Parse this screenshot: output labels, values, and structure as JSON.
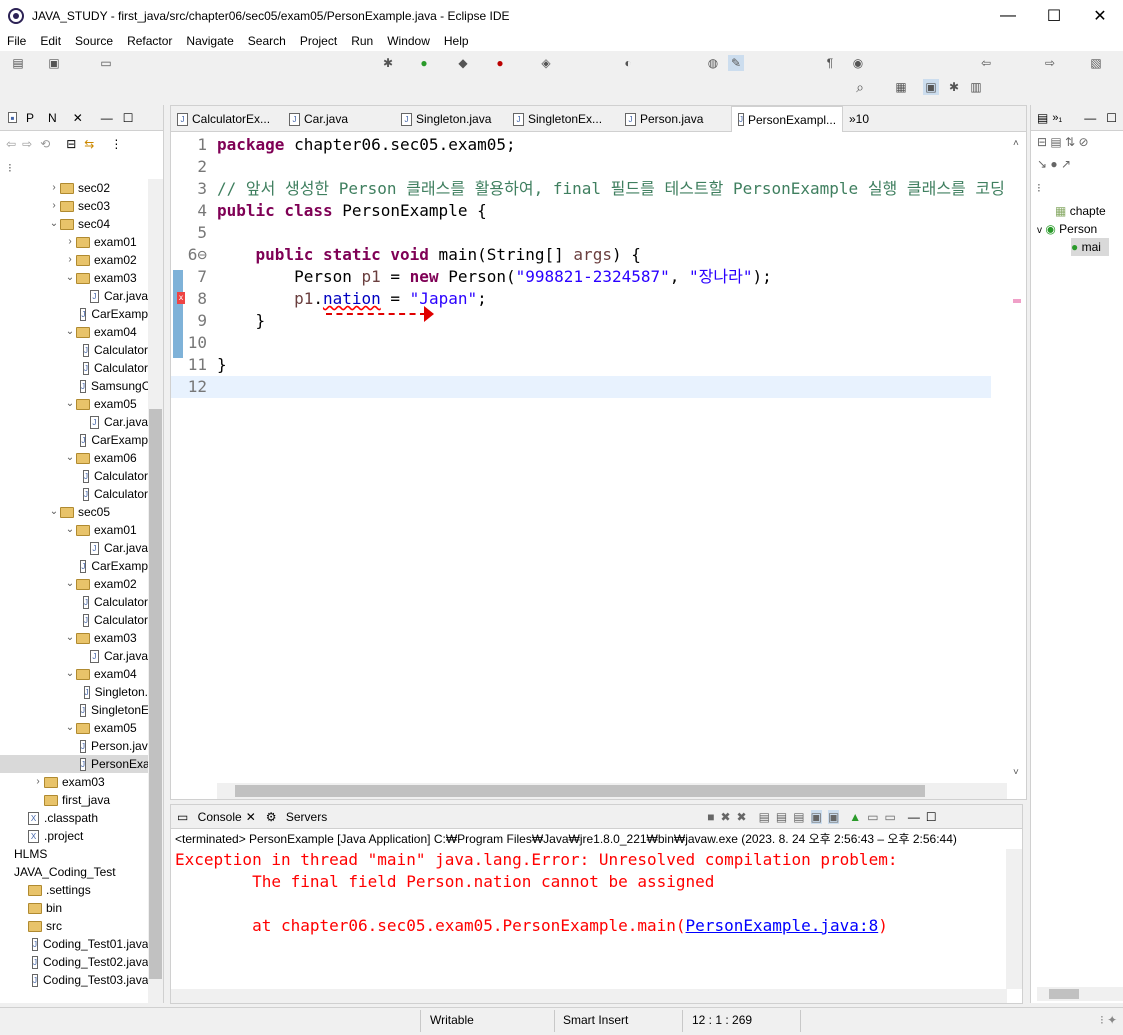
{
  "window": {
    "title": "JAVA_STUDY - first_java/src/chapter06/sec05/exam05/PersonExample.java - Eclipse IDE"
  },
  "menu": [
    "File",
    "Edit",
    "Source",
    "Refactor",
    "Navigate",
    "Search",
    "Project",
    "Run",
    "Window",
    "Help"
  ],
  "left_panel": {
    "tabs": [
      "P",
      "N"
    ],
    "tree": [
      {
        "indent": 2,
        "arrow": ">",
        "type": "folder",
        "label": "sec02"
      },
      {
        "indent": 2,
        "arrow": ">",
        "type": "folder",
        "label": "sec03"
      },
      {
        "indent": 2,
        "arrow": "v",
        "type": "folder",
        "label": "sec04"
      },
      {
        "indent": 3,
        "arrow": ">",
        "type": "folder",
        "label": "exam01"
      },
      {
        "indent": 3,
        "arrow": ">",
        "type": "folder",
        "label": "exam02"
      },
      {
        "indent": 3,
        "arrow": "v",
        "type": "folder",
        "label": "exam03"
      },
      {
        "indent": 4,
        "arrow": "",
        "type": "file",
        "label": "Car.java"
      },
      {
        "indent": 4,
        "arrow": "",
        "type": "file",
        "label": "CarExamp"
      },
      {
        "indent": 3,
        "arrow": "v",
        "type": "folder",
        "label": "exam04"
      },
      {
        "indent": 4,
        "arrow": "",
        "type": "file",
        "label": "Calculator"
      },
      {
        "indent": 4,
        "arrow": "",
        "type": "file",
        "label": "Calculator"
      },
      {
        "indent": 4,
        "arrow": "",
        "type": "file",
        "label": "SamsungC"
      },
      {
        "indent": 3,
        "arrow": "v",
        "type": "folder",
        "label": "exam05"
      },
      {
        "indent": 4,
        "arrow": "",
        "type": "file",
        "label": "Car.java"
      },
      {
        "indent": 4,
        "arrow": "",
        "type": "file",
        "label": "CarExamp"
      },
      {
        "indent": 3,
        "arrow": "v",
        "type": "folder",
        "label": "exam06"
      },
      {
        "indent": 4,
        "arrow": "",
        "type": "file",
        "label": "Calculator"
      },
      {
        "indent": 4,
        "arrow": "",
        "type": "file",
        "label": "Calculator"
      },
      {
        "indent": 2,
        "arrow": "v",
        "type": "folder",
        "label": "sec05"
      },
      {
        "indent": 3,
        "arrow": "v",
        "type": "folder",
        "label": "exam01"
      },
      {
        "indent": 4,
        "arrow": "",
        "type": "file",
        "label": "Car.java"
      },
      {
        "indent": 4,
        "arrow": "",
        "type": "file",
        "label": "CarExamp"
      },
      {
        "indent": 3,
        "arrow": "v",
        "type": "folder",
        "label": "exam02"
      },
      {
        "indent": 4,
        "arrow": "",
        "type": "file",
        "label": "Calculator"
      },
      {
        "indent": 4,
        "arrow": "",
        "type": "file",
        "label": "Calculator"
      },
      {
        "indent": 3,
        "arrow": "v",
        "type": "folder",
        "label": "exam03"
      },
      {
        "indent": 4,
        "arrow": "",
        "type": "file",
        "label": "Car.java"
      },
      {
        "indent": 3,
        "arrow": "v",
        "type": "folder",
        "label": "exam04"
      },
      {
        "indent": 4,
        "arrow": "",
        "type": "file",
        "label": "Singleton."
      },
      {
        "indent": 4,
        "arrow": "",
        "type": "file",
        "label": "SingletonE"
      },
      {
        "indent": 3,
        "arrow": "v",
        "type": "folder",
        "label": "exam05"
      },
      {
        "indent": 4,
        "arrow": "",
        "type": "file",
        "label": "Person.java"
      },
      {
        "indent": 4,
        "arrow": "",
        "type": "file",
        "label": "PersonExa",
        "selected": true
      },
      {
        "indent": 1,
        "arrow": ">",
        "type": "folder",
        "label": "exam03"
      },
      {
        "indent": 1,
        "arrow": "",
        "type": "folder",
        "label": "first_java"
      },
      {
        "indent": 0,
        "arrow": "",
        "type": "xfile",
        "label": ".classpath"
      },
      {
        "indent": 0,
        "arrow": "",
        "type": "xfile",
        "label": ".project"
      },
      {
        "indent": -1,
        "arrow": "",
        "type": "none",
        "label": "HLMS"
      },
      {
        "indent": -1,
        "arrow": "",
        "type": "none",
        "label": "JAVA_Coding_Test"
      },
      {
        "indent": 0,
        "arrow": "",
        "type": "folder",
        "label": ".settings"
      },
      {
        "indent": 0,
        "arrow": "",
        "type": "folder",
        "label": "bin"
      },
      {
        "indent": 0,
        "arrow": "",
        "type": "folder",
        "label": "src"
      },
      {
        "indent": 1,
        "arrow": "",
        "type": "file",
        "label": "Coding_Test01.java"
      },
      {
        "indent": 1,
        "arrow": "",
        "type": "file",
        "label": "Coding_Test02.java"
      },
      {
        "indent": 1,
        "arrow": "",
        "type": "file",
        "label": "Coding_Test03.java"
      }
    ]
  },
  "editor": {
    "tabs": [
      {
        "label": "CalculatorEx..."
      },
      {
        "label": "Car.java"
      },
      {
        "label": "Singleton.java"
      },
      {
        "label": "SingletonEx..."
      },
      {
        "label": "Person.java"
      },
      {
        "label": "PersonExampl...",
        "active": true
      }
    ],
    "overflow_tab": "»10",
    "lines": [
      {
        "n": "1",
        "html": "<span class='kw'>package</span> chapter06.sec05.exam05;"
      },
      {
        "n": "2",
        "html": ""
      },
      {
        "n": "3",
        "html": "<span class='cm'>// 앞서 생성한 Person 클래스를 활용하여, final 필드를 테스트할 PersonExample 실행 클래스를 코딩</span>"
      },
      {
        "n": "4",
        "html": "<span class='kw'>public class</span> PersonExample {"
      },
      {
        "n": "5",
        "html": ""
      },
      {
        "n": "6⊖",
        "html": "    <span class='kw'>public static void</span> main(String[] <span class='var'>args</span>) {"
      },
      {
        "n": "7",
        "html": "        Person <span class='var'>p1</span> = <span class='kw'>new</span> Person(<span class='str'>\"998821-2324587\"</span>, <span class='str'>\"장나라\"</span>);"
      },
      {
        "n": "8",
        "html": "        <span class='var'>p1</span>.<span class='fld'>nation</span> = <span class='str'>\"Japan\"</span>;"
      },
      {
        "n": "9",
        "html": "    }"
      },
      {
        "n": "10",
        "html": ""
      },
      {
        "n": "11",
        "html": "}"
      },
      {
        "n": "12",
        "html": ""
      }
    ]
  },
  "outline": {
    "items": [
      "chapte",
      "Person",
      "mai"
    ]
  },
  "console": {
    "tabs": [
      "Console",
      "Servers"
    ],
    "header": "<terminated> PersonExample [Java Application] C:₩Program Files₩Java₩jre1.8.0_221₩bin₩javaw.exe  (2023. 8. 24 오후 2:56:43 – 오후 2:56:44)",
    "line1": "Exception in thread \"main\" java.lang.Error: Unresolved compilation problem: ",
    "line2": "        The final field Person.nation cannot be assigned",
    "line3": "",
    "line4_prefix": "        at chapter06.sec05.exam05.PersonExample.main(",
    "line4_link": "PersonExample.java:8",
    "line4_suffix": ")"
  },
  "status": {
    "writable": "Writable",
    "insert": "Smart Insert",
    "position": "12 : 1 : 269"
  },
  "colors": {
    "keyword": "#7f0055",
    "string": "#2a00ff",
    "comment": "#3f7f5f",
    "error": "#ff0000"
  }
}
